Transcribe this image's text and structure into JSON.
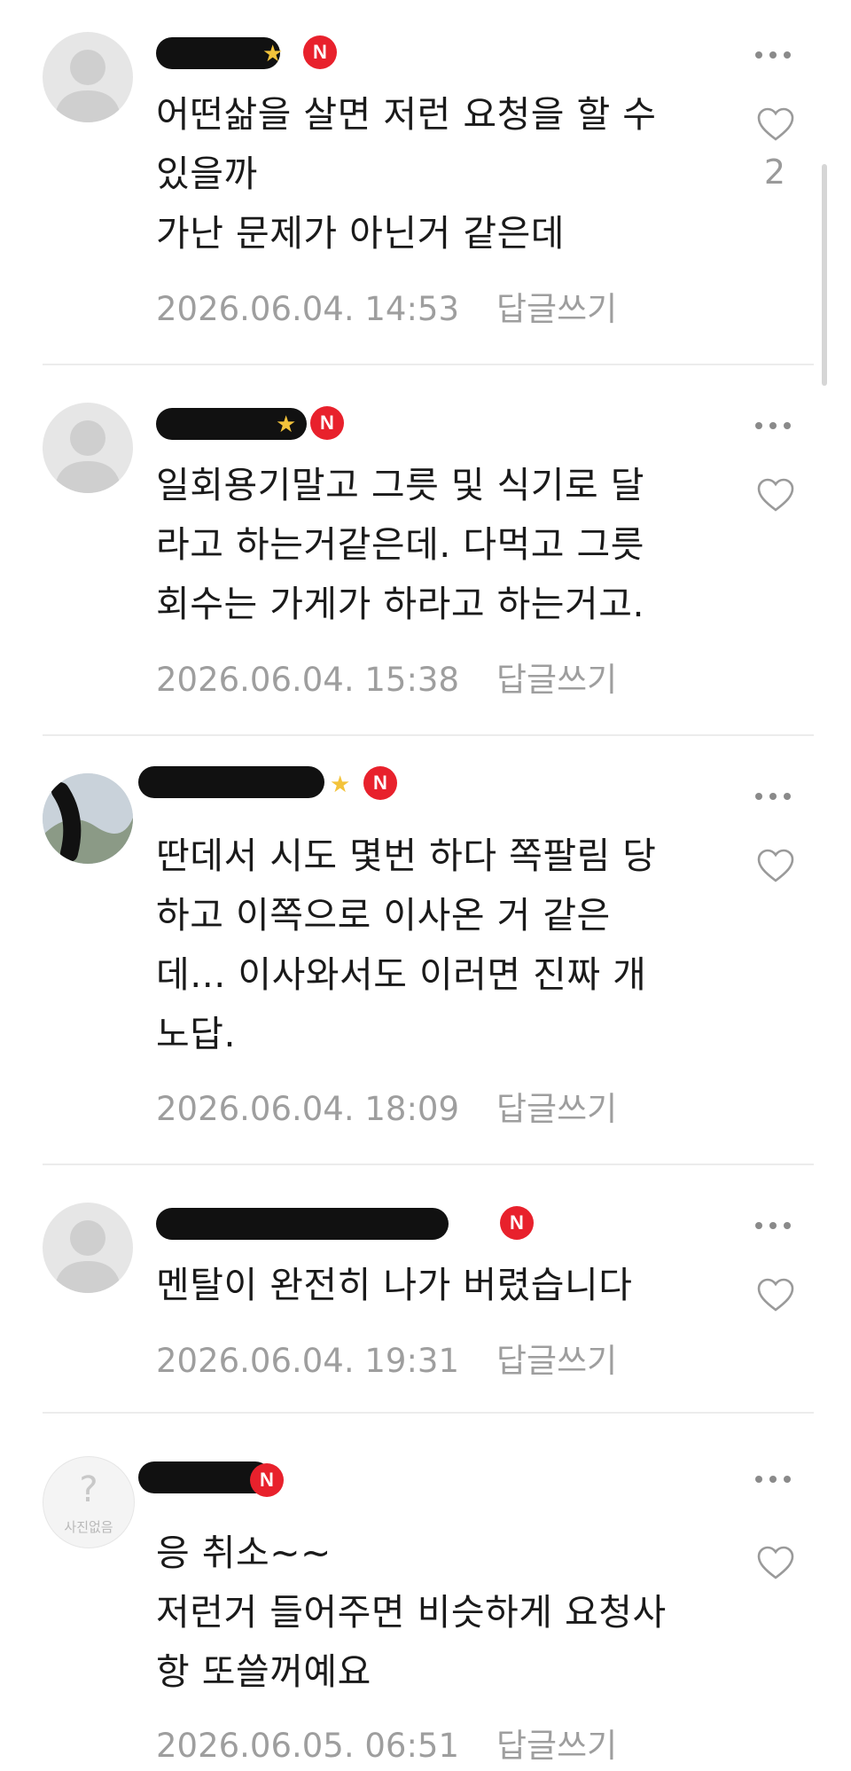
{
  "comments": [
    {
      "text": "어떤삶을 살면 저런 요청을 할 수\n있을까\n가난 문제가 아닌거 같은데",
      "date": "2026.06.04. 14:53",
      "reply_label": "답글쓰기",
      "likes": "2",
      "badge": "N"
    },
    {
      "text": "일회용기말고 그릇 및 식기로 달\n라고 하는거같은데. 다먹고 그릇\n회수는 가게가 하라고 하는거고.",
      "date": "2026.06.04. 15:38",
      "reply_label": "답글쓰기",
      "badge": "N"
    },
    {
      "text": "딴데서 시도 몇번 하다 쪽팔림 당\n하고 이쪽으로 이사온 거 같은\n데... 이사와서도 이러면 진짜 개\n노답.",
      "date": "2026.06.04. 18:09",
      "reply_label": "답글쓰기",
      "badge": "N"
    },
    {
      "text": "멘탈이 완전히 나가 버렸습니다",
      "date": "2026.06.04. 19:31",
      "reply_label": "답글쓰기",
      "badge": "N"
    },
    {
      "text": "응 취소~~\n저런거 들어주면 비슷하게 요청사\n항 또쓸꺼예요",
      "date": "2026.06.05. 06:51",
      "reply_label": "답글쓰기",
      "badge": "N",
      "avatar_caption": "사진없음"
    }
  ],
  "icons": {
    "more": "more-dots-icon",
    "heart": "heart-outline-icon",
    "avatar": "default-profile-icon",
    "star": "star-icon"
  },
  "colors": {
    "badge": "#e8212c",
    "star": "#f3c33b",
    "meta_text": "#9e9e9e"
  }
}
